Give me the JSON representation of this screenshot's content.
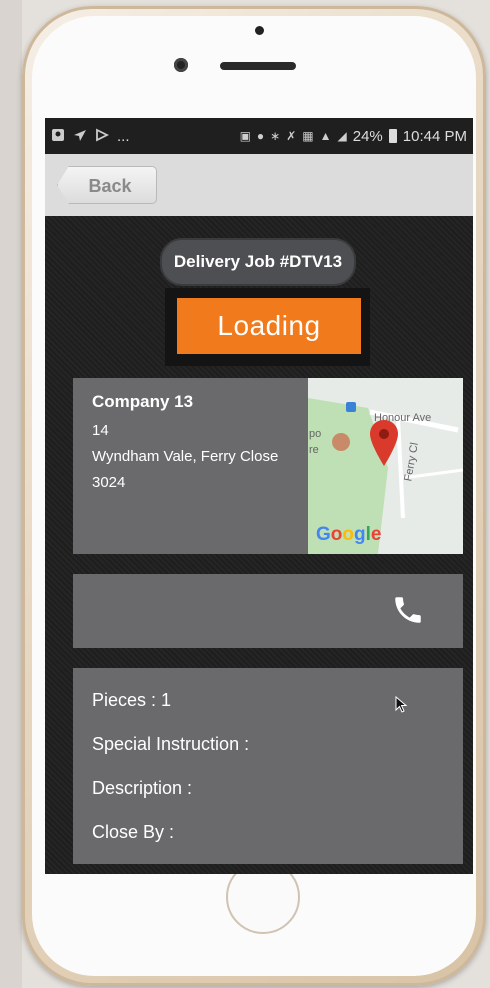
{
  "statusbar": {
    "left_icons": [
      "location-pin-icon",
      "navigation-icon",
      "play-icon"
    ],
    "ellipsis": "...",
    "battery": "24%",
    "time": "10:44 PM"
  },
  "actionbar": {
    "back_label": "Back"
  },
  "job": {
    "title": "Delivery Job #DTV13",
    "status": "Loading"
  },
  "address": {
    "company": "Company 13",
    "line1": "14",
    "line2": "Wyndham Vale, Ferry Close",
    "line3": "3024"
  },
  "map": {
    "street1": "Honour Ave",
    "street2": "Ferry Cl",
    "partial_labels": [
      "po",
      "re"
    ],
    "provider": "Google",
    "pin_color": "#d93a2b"
  },
  "contact": {
    "icon": "phone-icon"
  },
  "details": {
    "pieces": "Pieces : 1",
    "special_instruction": "Special Instruction :",
    "description": "Description :",
    "close_by": "Close By :"
  },
  "colors": {
    "accent": "#f07a1c",
    "card": "#6a6a6c",
    "screen_bg": "#1e1e1e"
  }
}
